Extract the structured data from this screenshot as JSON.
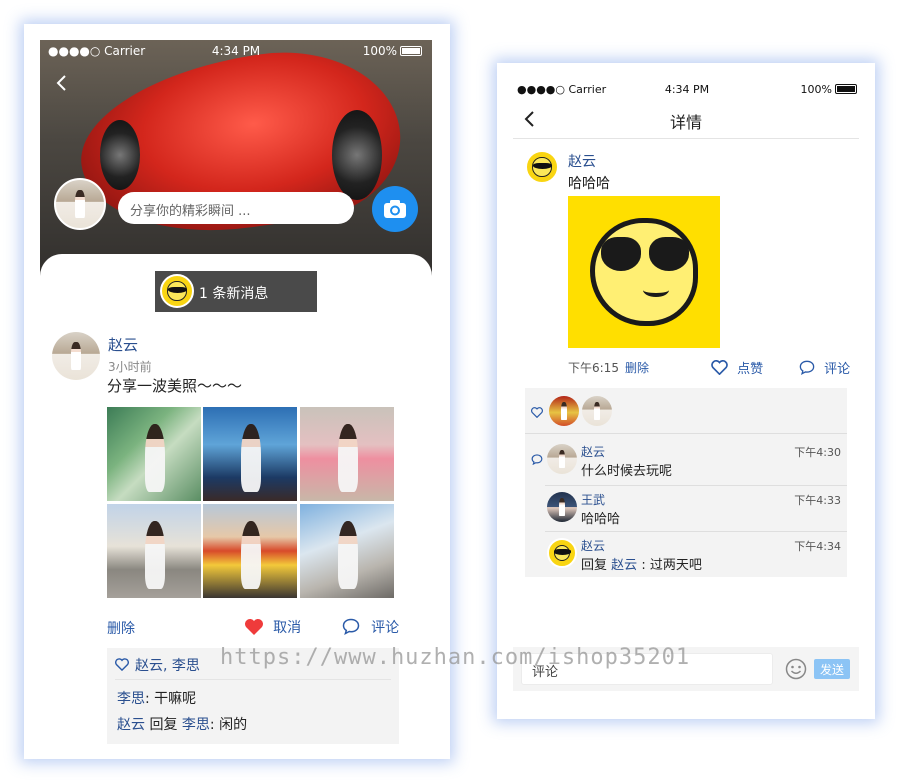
{
  "left_phone": {
    "status": {
      "carrier": "●●●●○ Carrier",
      "time": "4:34 PM",
      "battery": "100%"
    },
    "share_placeholder": "分享你的精彩瞬间 ...",
    "new_message": "1 条新消息",
    "post": {
      "author": "赵云",
      "time_ago": "3小时前",
      "text": "分享一波美照～～～",
      "actions": {
        "delete": "删除",
        "cancel_like": "取消",
        "comment": "评论"
      },
      "likes": "赵云, 李思",
      "comments": [
        {
          "author": "李思",
          "sep": ":",
          "text": "干嘛呢"
        },
        {
          "author": "赵云",
          "reply_word": "回复",
          "reply_to": "李思",
          "sep": ":",
          "text": "闲的"
        }
      ]
    }
  },
  "right_phone": {
    "status": {
      "carrier": "●●●●○ Carrier",
      "time": "4:34 PM",
      "battery": "100%"
    },
    "title": "详情",
    "post": {
      "author": "赵云",
      "text": "哈哈哈",
      "time": "下午6:15",
      "delete": "删除",
      "like": "点赞",
      "comment": "评论"
    },
    "comments": [
      {
        "author": "赵云",
        "text": "什么时候去玩呢",
        "time": "下午4:30"
      },
      {
        "author": "王武",
        "text": "哈哈哈",
        "time": "下午4:33"
      },
      {
        "author": "赵云",
        "reply_word": "回复",
        "reply_to": "赵云",
        "text": ": 过两天吧",
        "time": "下午4:34"
      }
    ],
    "input_placeholder": "评论",
    "send": "发送"
  },
  "watermark": "https://www.huzhan.com/ishop35201",
  "colors": {
    "accent": "#2a5aa8",
    "camera": "#1e8ff0",
    "like_red": "#ef3b3b",
    "send": "#8cc4f5",
    "sticker_yellow": "#ffdf00"
  }
}
